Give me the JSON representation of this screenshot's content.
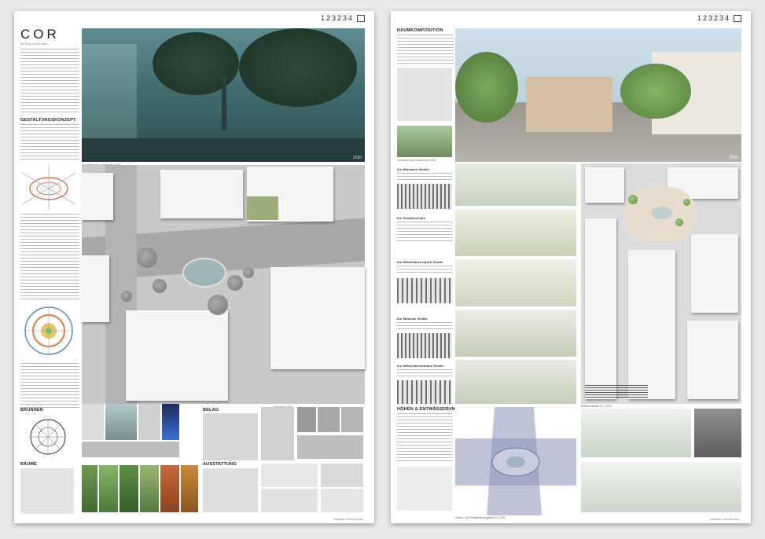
{
  "left_sheet": {
    "id": "123234",
    "logo": "COR",
    "logo_sub": "Ein Platz für die Stadt",
    "hero_caption": "Visualisierung, Ausschnitt, 2030",
    "hero_year": "2030",
    "gestaltungskonzept": "GESTALTUNGSKONZEPT",
    "plan_caption": "Lageplan 1:500",
    "brunnen": "BRUNNEN",
    "baeume": "BÄUME",
    "belag": "BELAG",
    "ausstattung": "AUSSTATTUNG",
    "footer": "Stadtplatz, Sachsenplatz"
  },
  "right_sheet": {
    "id": "123234",
    "raumkomposition": "RAUMKOMPOSITION",
    "hoehen": "HÖHEN & ENTWÄSSERUNG",
    "hero_caption": "Visualisierung, Ausschnitt, 2030",
    "hero_year": "2030",
    "sections": [
      "Zur Bismarck Straße",
      "Zur Schillerstraße",
      "Zur Wittelsbacherpark Straße",
      "Zur Museum Straße",
      "Zur Wittelsbacherhaus Straße"
    ],
    "plan_caption": "Übersichtsplan M 1:1000",
    "hoehen_caption": "Höhen- und Entwässerungsplan M 1:500",
    "footer": "Stadtplatz, Sachsenplatz"
  }
}
